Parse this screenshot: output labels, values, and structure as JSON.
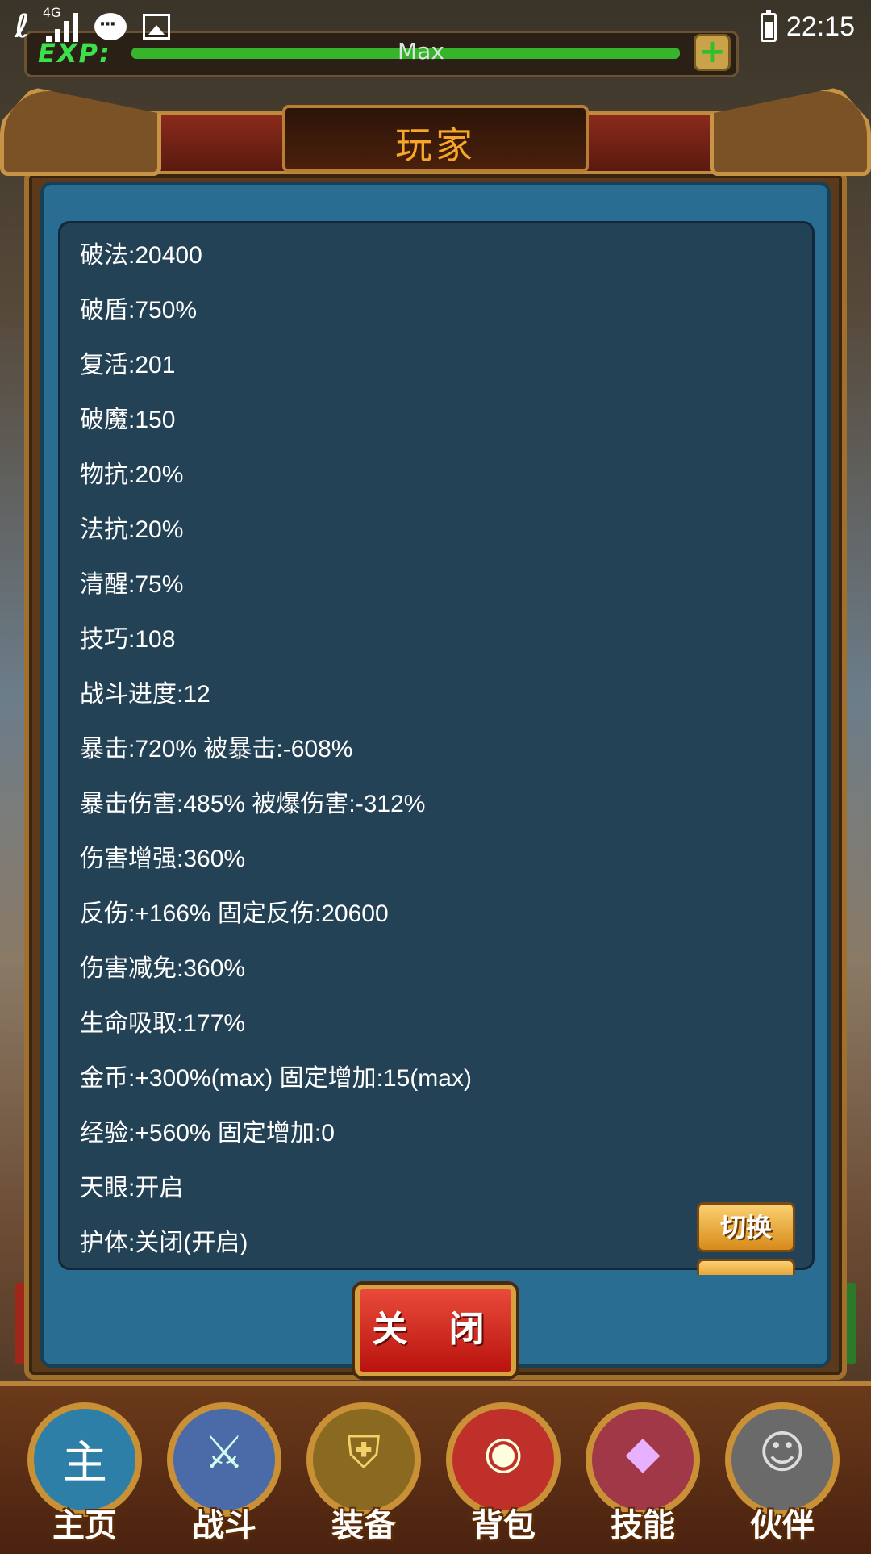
{
  "status_bar": {
    "carrier_icon": "telecom-logo",
    "network": "4G",
    "time": "22:15"
  },
  "top_hud": {
    "exp_label": "EXP:",
    "exp_value": "Max",
    "exp_progress": 1.0,
    "plus_label": "+"
  },
  "dialog": {
    "title": "玩家",
    "stats": [
      "破法:20400",
      "破盾:750%",
      "复活:201",
      "破魔:150",
      "物抗:20%",
      "法抗:20%",
      "清醒:75%",
      "技巧:108",
      "战斗进度:12",
      "暴击:720% 被暴击:-608%",
      "暴击伤害:485% 被爆伤害:-312%",
      "伤害增强:360%",
      "反伤:+166% 固定反伤:20600",
      "伤害减免:360%",
      "生命吸取:177%",
      "金币:+300%(max) 固定增加:15(max)",
      "经验:+560% 固定增加:0",
      "天眼:开启",
      "护体:关闭(开启)"
    ],
    "switch_label": "切换",
    "close_label": "关 闭"
  },
  "bottom_nav": {
    "items": [
      {
        "label": "主页",
        "icon": "home-icon",
        "glyph": "主",
        "color": "#2d7fa8"
      },
      {
        "label": "战斗",
        "icon": "swords-icon",
        "glyph": "⚔",
        "color": "#4a6aa8"
      },
      {
        "label": "装备",
        "icon": "armor-icon",
        "glyph": "⛨",
        "color": "#8a6a20"
      },
      {
        "label": "背包",
        "icon": "bag-icon",
        "glyph": "◉",
        "color": "#c0302a"
      },
      {
        "label": "技能",
        "icon": "skill-book-icon",
        "glyph": "◆",
        "color": "#a03848"
      },
      {
        "label": "伙伴",
        "icon": "companion-icon",
        "glyph": "☺",
        "color": "#6a6a6a"
      }
    ]
  }
}
